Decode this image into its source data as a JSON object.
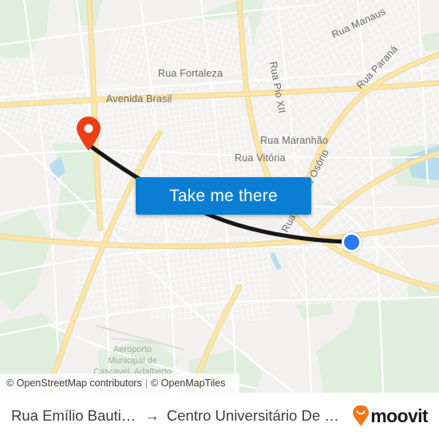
{
  "map": {
    "provider_labels": {
      "osm": "© OpenStreetMap contributors",
      "separator": "|",
      "tiles": "© OpenMapTiles"
    },
    "street_labels": [
      {
        "name": "Rua Fortaleza"
      },
      {
        "name": "Rua Manaus"
      },
      {
        "name": "Rua Paraná"
      },
      {
        "name": "Rua Pio XII"
      },
      {
        "name": "Avenida Brasil"
      },
      {
        "name": "Rua Maranhão"
      },
      {
        "name": "Rua Vitória"
      },
      {
        "name": "Rua General Osório"
      }
    ],
    "place_labels": [
      {
        "line1": "Aeroporto",
        "line2": "Municipal de",
        "line3": "Cascavel, Adalberto"
      }
    ],
    "markers": {
      "origin": {
        "icon": "map-pin-icon",
        "color": "#eb3f17"
      },
      "destination": {
        "icon": "location-dot-icon",
        "color": "#2979f2"
      }
    },
    "route": {
      "color": "#18181a"
    },
    "colors": {
      "land": "#f2f1ef",
      "park": "#dfeedd",
      "water": "#b3d9e8",
      "major_road": "#f8d88c",
      "minor_road": "#ffffff"
    }
  },
  "cta": {
    "label": "Take me there",
    "color": "#0b7ed4"
  },
  "footer": {
    "origin": "Rua Emílio Bautitz, ...",
    "arrow": "→",
    "destination": "Centro Universitário De Casc...",
    "brand": {
      "word": "moovit",
      "pin_color": "#f27313"
    }
  }
}
